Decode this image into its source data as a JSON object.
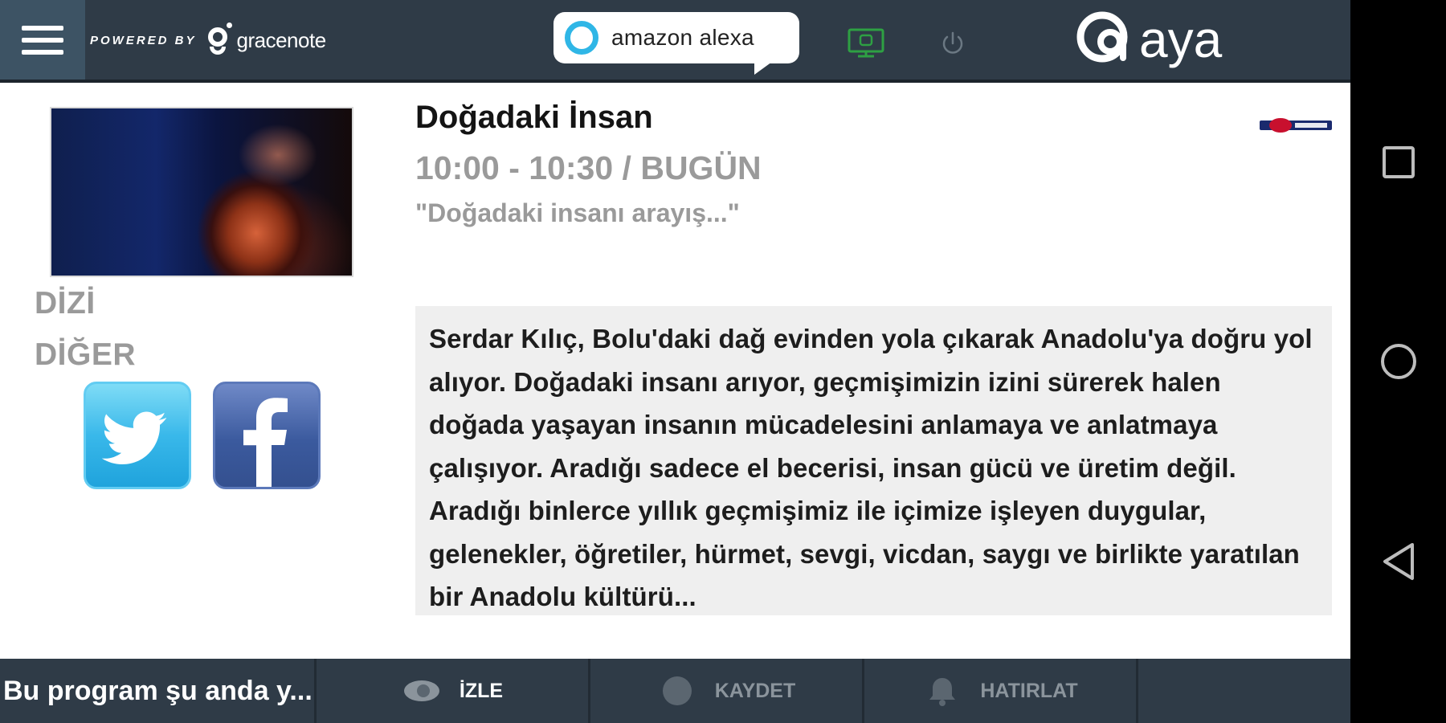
{
  "header": {
    "powered_by": "POWERED BY",
    "gracenote": "gracenote",
    "alexa": "amazon alexa",
    "brand_logo": "aya"
  },
  "program": {
    "title": "Doğadaki İnsan",
    "time": "10:00 - 10:30 / BUGÜN",
    "subtitle": "\"Doğadaki insanı arayış...\"",
    "categories": [
      "DİZİ",
      "DİĞER"
    ],
    "description": "Serdar Kılıç, Bolu'daki dağ evinden yola çıkarak Anadolu'ya doğru yol alıyor. Doğadaki insanı arıyor, geçmişimizin izini sürerek halen doğada yaşayan insanın mücadelesini anlamaya ve anlatmaya çalışıyor. Aradığı sadece el becerisi, insan gücü ve üretim değil. Aradığı binlerce yıllık geçmişimiz ile içimize işleyen duygular, gelenekler, öğretiler, hürmet, sevgi, vicdan, saygı ve birlikte yaratılan bir Anadolu kültürü..."
  },
  "footer": {
    "status": "Bu program şu anda y...",
    "actions": [
      {
        "label": "İZLE",
        "icon": "eye-icon"
      },
      {
        "label": "KAYDET",
        "icon": "record-icon"
      },
      {
        "label": "HATIRLAT",
        "icon": "bell-icon"
      }
    ]
  },
  "colors": {
    "bar": "#2f3b47",
    "menu": "#3d5364",
    "alexa_ring": "#2fb6e6",
    "tv_icon": "#2ea043",
    "twitter": "#39b8ea",
    "facebook": "#3b5a9e",
    "muted_text": "#9a9a9a"
  }
}
